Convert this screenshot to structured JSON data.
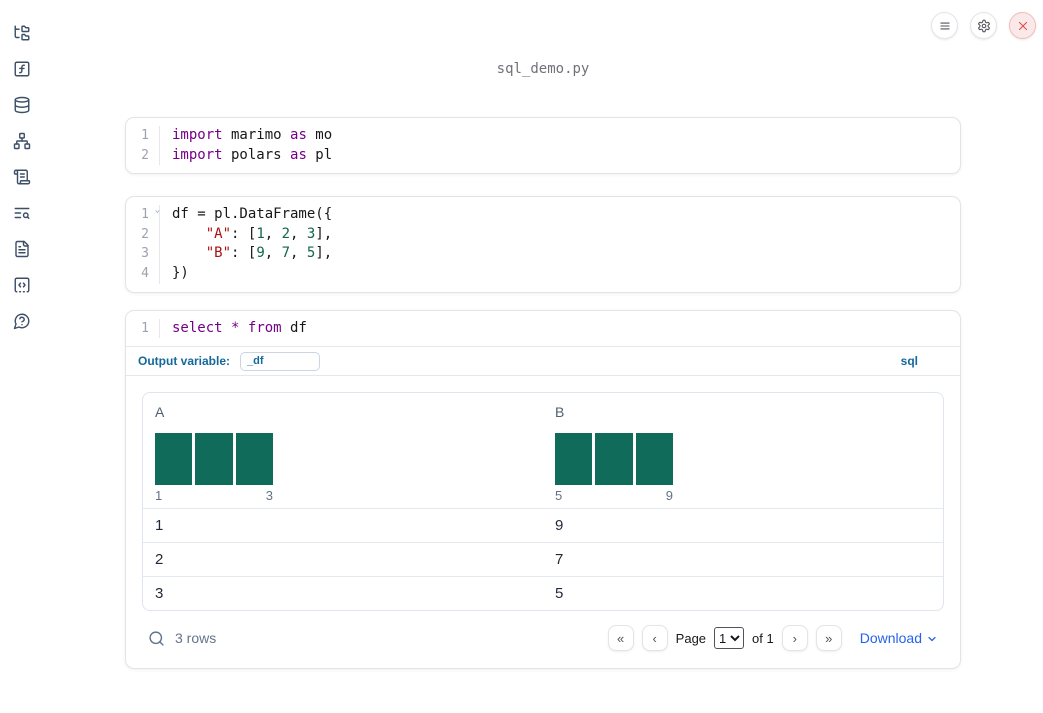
{
  "header": {
    "filename": "sql_demo.py"
  },
  "topbar": {
    "buttons": [
      {
        "name": "notebook-menu",
        "icon": "hamburger-icon"
      },
      {
        "name": "settings",
        "icon": "gear-icon"
      },
      {
        "name": "shutdown",
        "icon": "close-icon"
      }
    ]
  },
  "sidebar": {
    "items": [
      {
        "name": "file-explorer",
        "icon": "folder-tree-icon"
      },
      {
        "name": "variables",
        "icon": "function-square-icon"
      },
      {
        "name": "data-sources",
        "icon": "database-icon"
      },
      {
        "name": "dependency-graph",
        "icon": "network-icon"
      },
      {
        "name": "logs",
        "icon": "scroll-text-icon"
      },
      {
        "name": "tracebacks",
        "icon": "text-search-icon"
      },
      {
        "name": "documentation",
        "icon": "file-text-icon"
      },
      {
        "name": "scratchpad",
        "icon": "scratchpad-icon"
      },
      {
        "name": "help",
        "icon": "help-circle-icon"
      }
    ]
  },
  "cells": [
    {
      "name": "cell-imports",
      "lines": [
        {
          "num": "1",
          "fold": false,
          "tokens": [
            [
              "kw",
              "import"
            ],
            [
              "pl",
              " marimo "
            ],
            [
              "kw",
              "as"
            ],
            [
              "pl",
              " mo"
            ]
          ]
        },
        {
          "num": "2",
          "fold": false,
          "tokens": [
            [
              "kw",
              "import"
            ],
            [
              "pl",
              " polars "
            ],
            [
              "kw",
              "as"
            ],
            [
              "pl",
              " pl"
            ]
          ]
        }
      ]
    },
    {
      "name": "cell-dataframe",
      "lines": [
        {
          "num": "1",
          "fold": true,
          "tokens": [
            [
              "pl",
              "df = pl.DataFrame({"
            ]
          ]
        },
        {
          "num": "2",
          "fold": false,
          "tokens": [
            [
              "pl",
              "    "
            ],
            [
              "st",
              "\"A\""
            ],
            [
              "pl",
              ": ["
            ],
            [
              "nu",
              "1"
            ],
            [
              "pl",
              ", "
            ],
            [
              "nu",
              "2"
            ],
            [
              "pl",
              ", "
            ],
            [
              "nu",
              "3"
            ],
            [
              "pl",
              "],"
            ]
          ]
        },
        {
          "num": "3",
          "fold": false,
          "tokens": [
            [
              "pl",
              "    "
            ],
            [
              "st",
              "\"B\""
            ],
            [
              "pl",
              ": ["
            ],
            [
              "nu",
              "9"
            ],
            [
              "pl",
              ", "
            ],
            [
              "nu",
              "7"
            ],
            [
              "pl",
              ", "
            ],
            [
              "nu",
              "5"
            ],
            [
              "pl",
              "],"
            ]
          ]
        },
        {
          "num": "4",
          "fold": false,
          "tokens": [
            [
              "pl",
              "})"
            ]
          ]
        }
      ]
    }
  ],
  "sql_cell": {
    "lines": [
      {
        "num": "1",
        "fold": false,
        "tokens": [
          [
            "kw",
            "select"
          ],
          [
            "pl",
            " "
          ],
          [
            "kw",
            "*"
          ],
          [
            "pl",
            " "
          ],
          [
            "kw",
            "from"
          ],
          [
            "pl",
            " df"
          ]
        ]
      }
    ],
    "output_variable_label": "Output variable:",
    "output_variable_value": "_df",
    "language_badge": "sql"
  },
  "table": {
    "columns": [
      {
        "label": "A",
        "hist": {
          "values": [
            1,
            1,
            1
          ],
          "min_label": "1",
          "max_label": "3"
        }
      },
      {
        "label": "B",
        "hist": {
          "values": [
            1,
            1,
            1
          ],
          "min_label": "5",
          "max_label": "9"
        }
      }
    ],
    "rows": [
      [
        "1",
        "9"
      ],
      [
        "2",
        "7"
      ],
      [
        "3",
        "5"
      ]
    ],
    "footer": {
      "rows_text": "3 rows",
      "pagination": {
        "first": "«",
        "prev": "‹",
        "next": "›",
        "last": "»"
      },
      "page_label": "Page",
      "page_value": "1",
      "page_options": [
        "1"
      ],
      "of_text": "of 1",
      "download_label": "Download"
    }
  },
  "colors": {
    "accent_blue": "#15689c",
    "link_blue": "#2563eb",
    "histogram_teal": "#116b5b",
    "syntax_keyword": "#770088",
    "syntax_string": "#aa1111",
    "syntax_number": "#116644",
    "danger_red": "#de5050"
  }
}
